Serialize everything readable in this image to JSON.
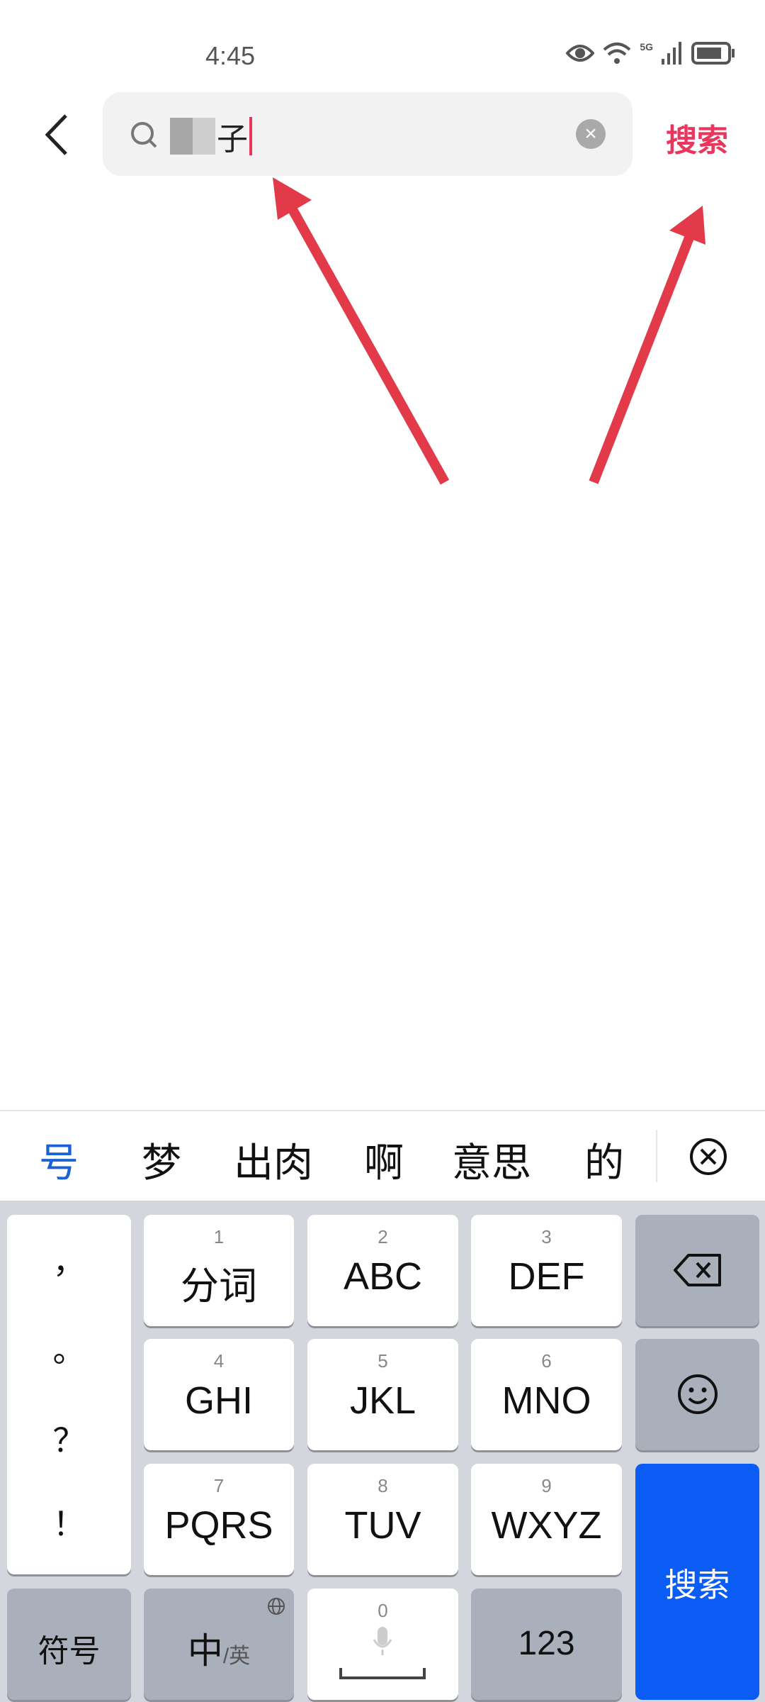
{
  "status_bar": {
    "time": "4:45",
    "network": "5G",
    "icons": [
      "eye-icon",
      "wifi-icon",
      "signal-icon",
      "battery-icon"
    ]
  },
  "header": {
    "query_visible": "子",
    "search_label": "搜索",
    "accent": "#e8365d"
  },
  "candidates": {
    "items": [
      "号",
      "梦",
      "出肉",
      "啊",
      "意思",
      "的"
    ],
    "selected_color": "#1a62d6"
  },
  "keyboard": {
    "punctuation": [
      "，",
      "。",
      "？",
      "！"
    ],
    "keys": [
      {
        "num": "1",
        "label": "分词"
      },
      {
        "num": "2",
        "label": "ABC"
      },
      {
        "num": "3",
        "label": "DEF"
      },
      {
        "num": "4",
        "label": "GHI"
      },
      {
        "num": "5",
        "label": "JKL"
      },
      {
        "num": "6",
        "label": "MNO"
      },
      {
        "num": "7",
        "label": "PQRS"
      },
      {
        "num": "8",
        "label": "TUV"
      },
      {
        "num": "9",
        "label": "WXYZ"
      }
    ],
    "symbols": "符号",
    "lang_main": "中",
    "lang_alt": "/英",
    "space_num": "0",
    "numbers": "123",
    "enter": "搜索",
    "enter_color": "#0b5cf5"
  }
}
